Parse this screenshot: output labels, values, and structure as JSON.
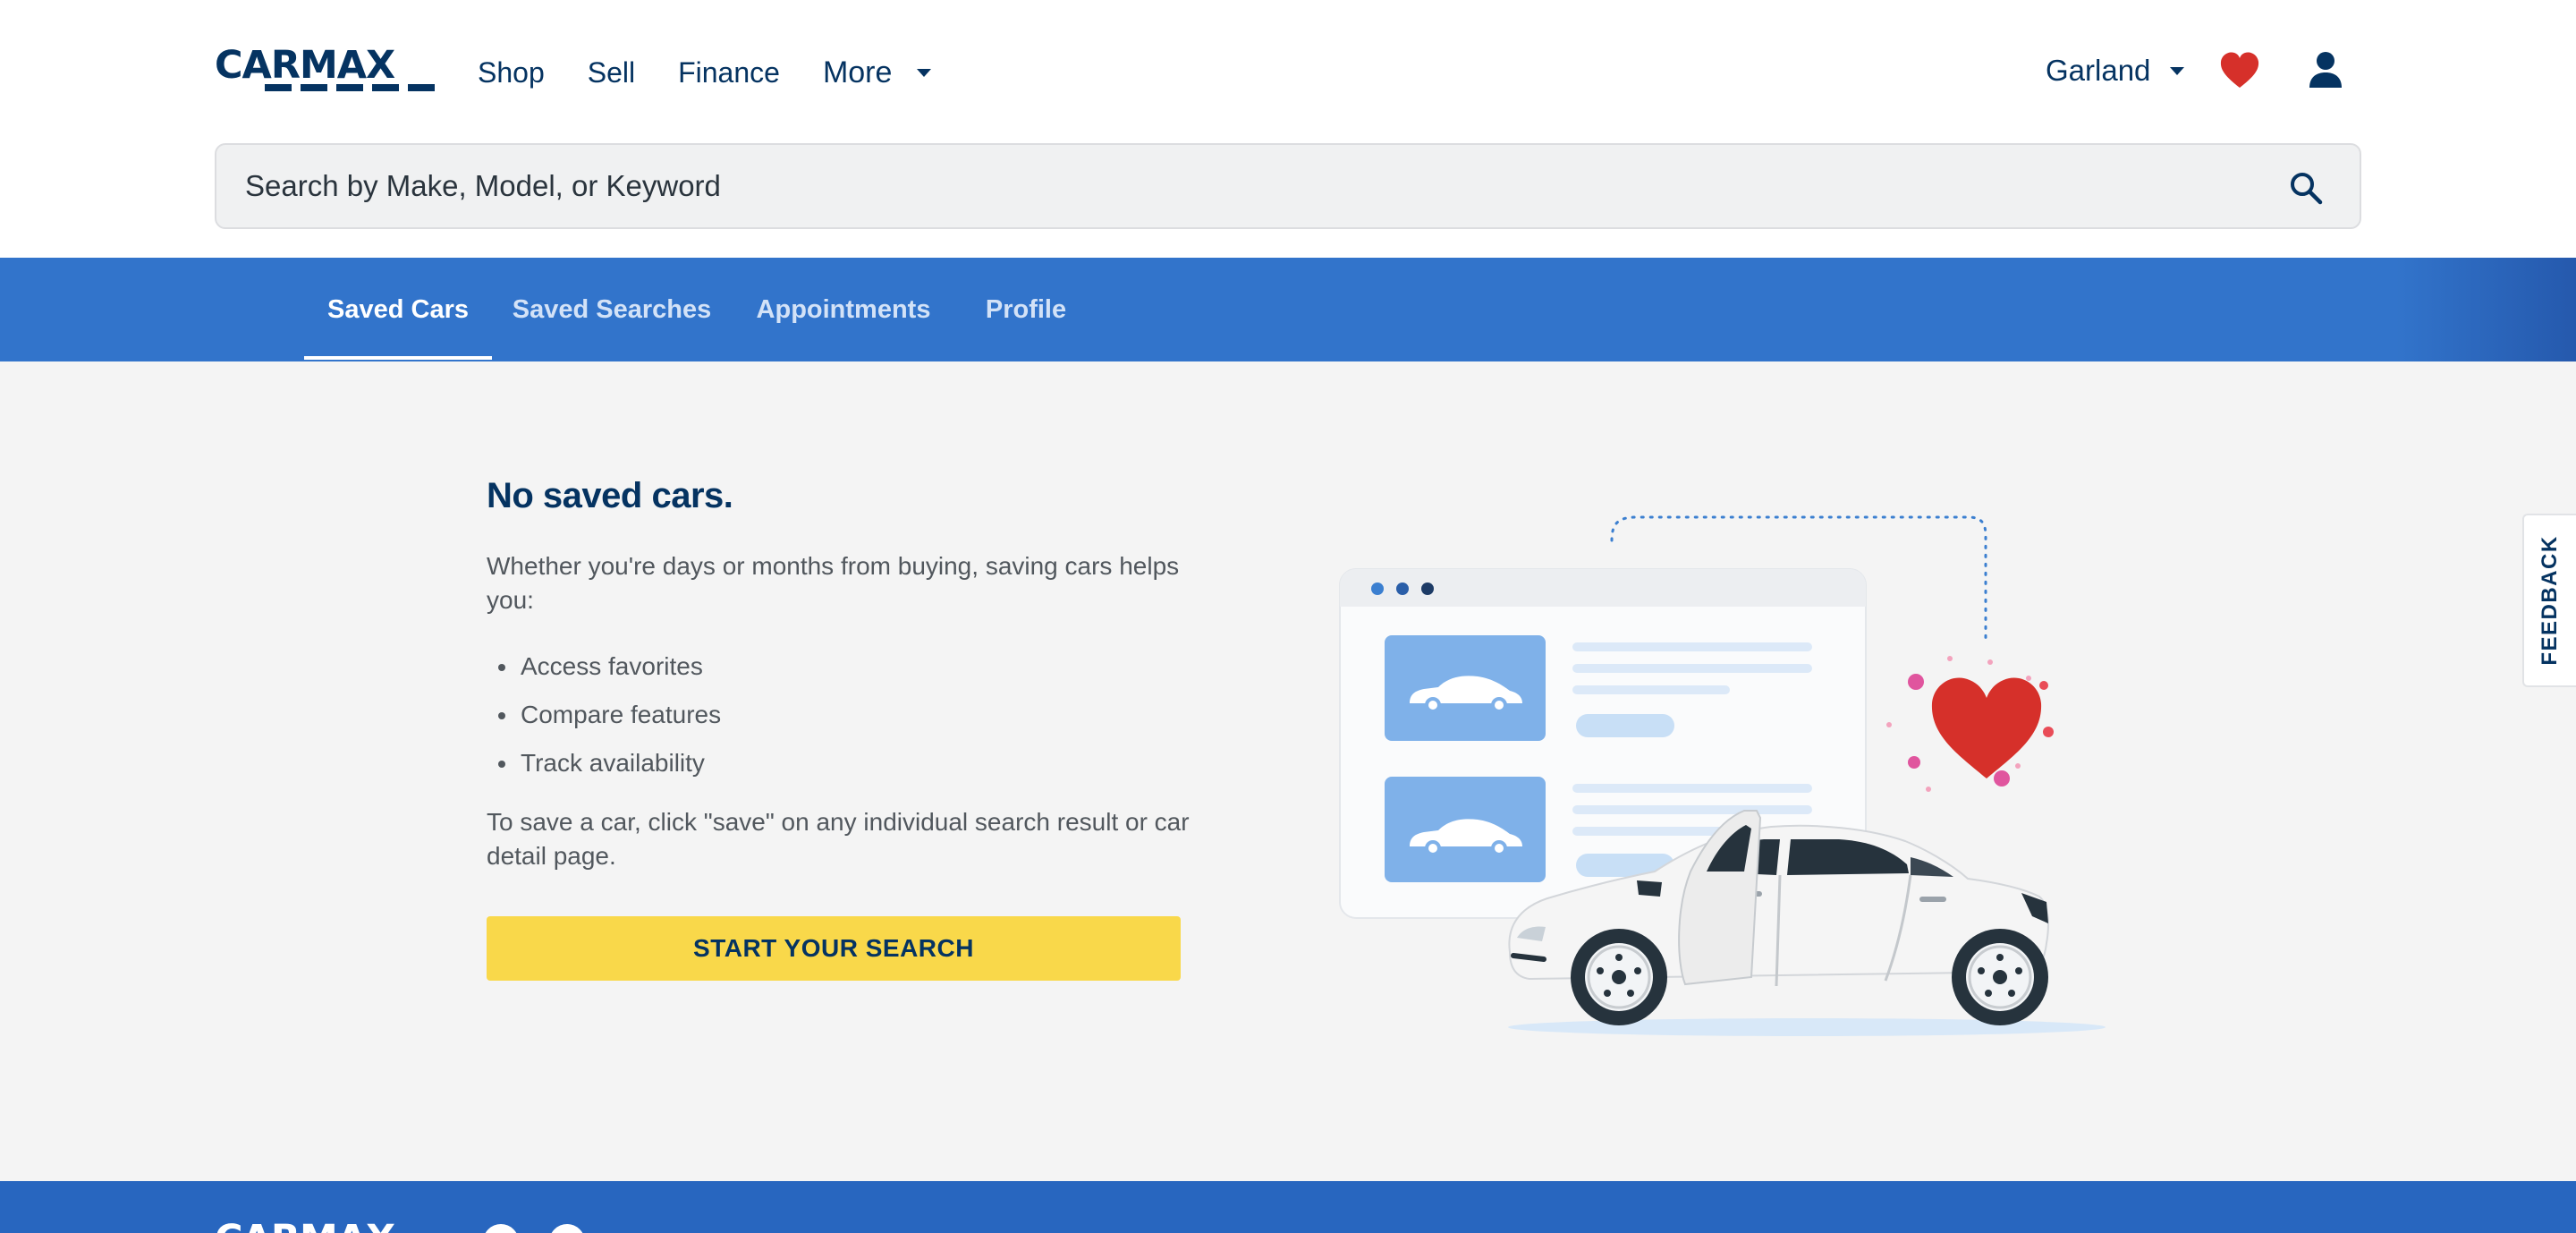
{
  "brand": {
    "name": "CARMAX"
  },
  "nav": {
    "shop": "Shop",
    "sell": "Sell",
    "finance": "Finance",
    "more": "More"
  },
  "store": {
    "name": "Garland"
  },
  "search": {
    "placeholder": "Search by Make, Model, or Keyword"
  },
  "tabs": [
    {
      "label": "Saved Cars",
      "active": true
    },
    {
      "label": "Saved Searches",
      "active": false
    },
    {
      "label": "Appointments",
      "active": false
    },
    {
      "label": "Profile",
      "active": false
    }
  ],
  "empty_state": {
    "title": "No saved cars.",
    "intro": "Whether you're days or months from buying, saving cars helps you:",
    "bullets": [
      "Access favorites",
      "Compare features",
      "Track availability"
    ],
    "howto": "To save a car, click \"save\" on any individual search result or car detail page.",
    "cta": "START YOUR SEARCH"
  },
  "feedback": {
    "label": "FEEDBACK"
  },
  "footer": {
    "brand": "CARMAX"
  },
  "colors": {
    "brand_navy": "#053361",
    "tab_blue": "#3274cb",
    "cta_yellow": "#f9d84a",
    "heart_red": "#d6302a",
    "page_bg": "#f4f4f4"
  },
  "icons": {
    "heart": "heart-icon",
    "user": "user-icon",
    "search": "search-icon",
    "caret": "caret-down-icon"
  }
}
